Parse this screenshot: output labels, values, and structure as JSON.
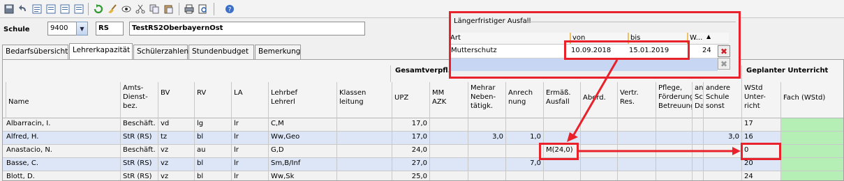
{
  "toolbar": {
    "icons": [
      "save-icon",
      "undo-icon",
      "form-icon",
      "form-icon",
      "form-icon",
      "form-icon",
      "refresh-icon",
      "broom-icon",
      "eye-icon",
      "cut-icon",
      "copy-icon",
      "paste-icon",
      "print-icon",
      "print-preview-icon",
      "help-icon"
    ]
  },
  "school": {
    "label": "Schule",
    "number": "9400",
    "type": "RS",
    "name": "TestRS2OberbayernOst"
  },
  "tabs": [
    "Bedarfsübersicht",
    "Lehrerkapazität",
    "Schülerzahlen",
    "Stundenbudget",
    "Bemerkung"
  ],
  "active_tab": "Lehrerkapazität",
  "grid": {
    "section_gesamt": "Gesamtverpfl.",
    "section_geplant": "Geplanter Unterricht",
    "columns": [
      "Name",
      "Amts-\nDienst-\nbez.",
      "BV",
      "RV",
      "LA",
      "Lehrbef\nLehrerl",
      "Klassen\nleitung",
      "UPZ",
      "MM\nAZK",
      "Mehrar\nNeben-\ntätigk.",
      "Anrech\nnung",
      "Ermäß.\nAusfall",
      "Aberd.",
      "Vertr.\nRes.",
      "Pflege,\nFörderung\nBetreuung",
      "an\nSc\nDa",
      "andere\nSchule\nsonst",
      "WStd\nUnter-\nricht",
      "Fach (WStd)"
    ],
    "rows": [
      {
        "name": "Albarracin, I.",
        "amt": "Beschäft.",
        "bv": "vd",
        "rv": "lg",
        "la": "lr",
        "lehrbef": "C,M",
        "kl": "",
        "upz": "17,0",
        "mm": "",
        "mehr": "",
        "anr": "",
        "erm": "",
        "abe": "",
        "vertr": "",
        "pfl": "",
        "an": "",
        "andere": "",
        "wstd": "17",
        "fach": ""
      },
      {
        "name": "Alfred, H.",
        "amt": "StR (RS)",
        "bv": "tz",
        "rv": "bl",
        "la": "lr",
        "lehrbef": "Ww,Geo",
        "kl": "",
        "upz": "17,0",
        "mm": "",
        "mehr": "3,0",
        "anr": "1,0",
        "erm": "",
        "abe": "",
        "vertr": "",
        "pfl": "",
        "an": "",
        "andere": "3,0",
        "wstd": "16",
        "fach": ""
      },
      {
        "name": "Anastacio, N.",
        "amt": "Beschäft.",
        "bv": "vz",
        "rv": "au",
        "la": "lr",
        "lehrbef": "G,D",
        "kl": "",
        "upz": "24,0",
        "mm": "",
        "mehr": "",
        "anr": "",
        "erm": "M(24,0)",
        "abe": "",
        "vertr": "",
        "pfl": "",
        "an": "",
        "andere": "",
        "wstd": "0",
        "fach": ""
      },
      {
        "name": "Basse, C.",
        "amt": "StR (RS)",
        "bv": "vz",
        "rv": "bl",
        "la": "lr",
        "lehrbef": "Sm,B/Inf",
        "kl": "",
        "upz": "27,0",
        "mm": "",
        "mehr": "",
        "anr": "7,0",
        "erm": "",
        "abe": "",
        "vertr": "",
        "pfl": "",
        "an": "",
        "andere": "",
        "wstd": "20",
        "fach": ""
      },
      {
        "name": "Blott, D.",
        "amt": "StR (RS)",
        "bv": "vz",
        "rv": "bl",
        "la": "lr",
        "lehrbef": "Ww,Sk",
        "kl": "",
        "upz": "25,0",
        "mm": "",
        "mehr": "",
        "anr": "",
        "erm": "",
        "abe": "",
        "vertr": "",
        "pfl": "",
        "an": "",
        "andere": "",
        "wstd": "24",
        "fach": ""
      }
    ]
  },
  "popup": {
    "title": "Längerfristiger Ausfall",
    "columns": [
      "Art",
      "von",
      "bis",
      "W..."
    ],
    "row": {
      "art": "Mutterschutz",
      "von": "10.09.2018",
      "bis": "15.01.2019",
      "w": "24"
    }
  },
  "colors": {
    "highlight": "#e8212b",
    "row_alt": "#dce6f7",
    "row_plain": "#f2f2f2",
    "green_cell": "#b6efb6",
    "arrow": "#e8212b"
  }
}
